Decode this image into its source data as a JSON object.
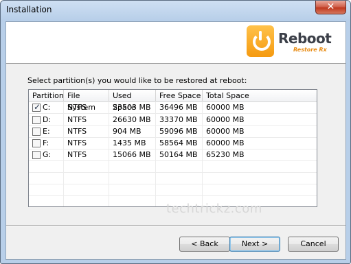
{
  "window": {
    "title": "Installation",
    "close_glyph": "✕"
  },
  "logo": {
    "icon": "power-restore-icon",
    "title": "Reboot",
    "subtitle": "Restore Rx"
  },
  "prompt": "Select partition(s) you would like to be restored at reboot:",
  "table": {
    "columns": [
      "Partition",
      "File System",
      "Used Space",
      "Free Space",
      "Total Space"
    ],
    "rows": [
      {
        "partition": "C:",
        "checked": true,
        "file_system": "NTFS",
        "used": "23503 MB",
        "free": "36496 MB",
        "total": "60000 MB"
      },
      {
        "partition": "D:",
        "checked": false,
        "file_system": "NTFS",
        "used": "26630 MB",
        "free": "33370 MB",
        "total": "60000 MB"
      },
      {
        "partition": "E:",
        "checked": false,
        "file_system": "NTFS",
        "used": "904 MB",
        "free": "59096 MB",
        "total": "60000 MB"
      },
      {
        "partition": "F:",
        "checked": false,
        "file_system": "NTFS",
        "used": "1435 MB",
        "free": "58564 MB",
        "total": "60000 MB"
      },
      {
        "partition": "G:",
        "checked": false,
        "file_system": "NTFS",
        "used": "15066 MB",
        "free": "50164 MB",
        "total": "65230 MB"
      }
    ]
  },
  "watermark": "techtrickz.com",
  "buttons": {
    "back": "< Back",
    "next": "Next >",
    "cancel": "Cancel"
  },
  "colors": {
    "logo_orange": "#f59a10",
    "title_bar": "#b8cfe9",
    "close_red": "#c0391f"
  }
}
